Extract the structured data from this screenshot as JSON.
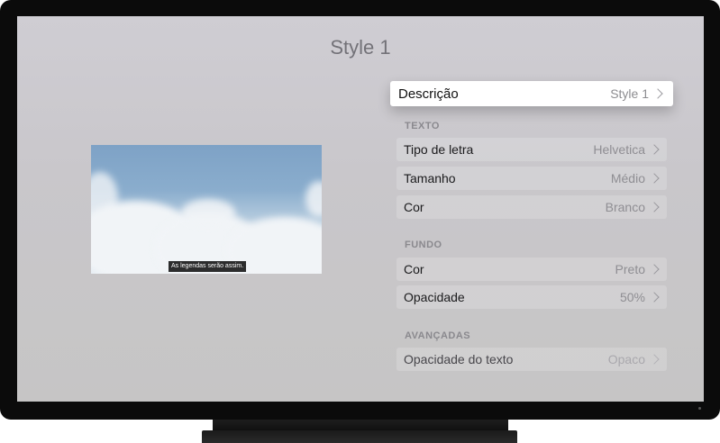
{
  "page": {
    "title": "Style 1"
  },
  "preview": {
    "caption": "As legendas serão assim."
  },
  "description": {
    "label": "Descrição",
    "value": "Style 1"
  },
  "sections": [
    {
      "header": "TEXTO",
      "rows": [
        {
          "label": "Tipo de letra",
          "value": "Helvetica"
        },
        {
          "label": "Tamanho",
          "value": "Médio"
        },
        {
          "label": "Cor",
          "value": "Branco"
        }
      ]
    },
    {
      "header": "FUNDO",
      "rows": [
        {
          "label": "Cor",
          "value": "Preto"
        },
        {
          "label": "Opacidade",
          "value": "50%"
        }
      ]
    },
    {
      "header": "AVANÇADAS",
      "rows": [
        {
          "label": "Opacidade do texto",
          "value": "Opaco"
        }
      ]
    }
  ]
}
